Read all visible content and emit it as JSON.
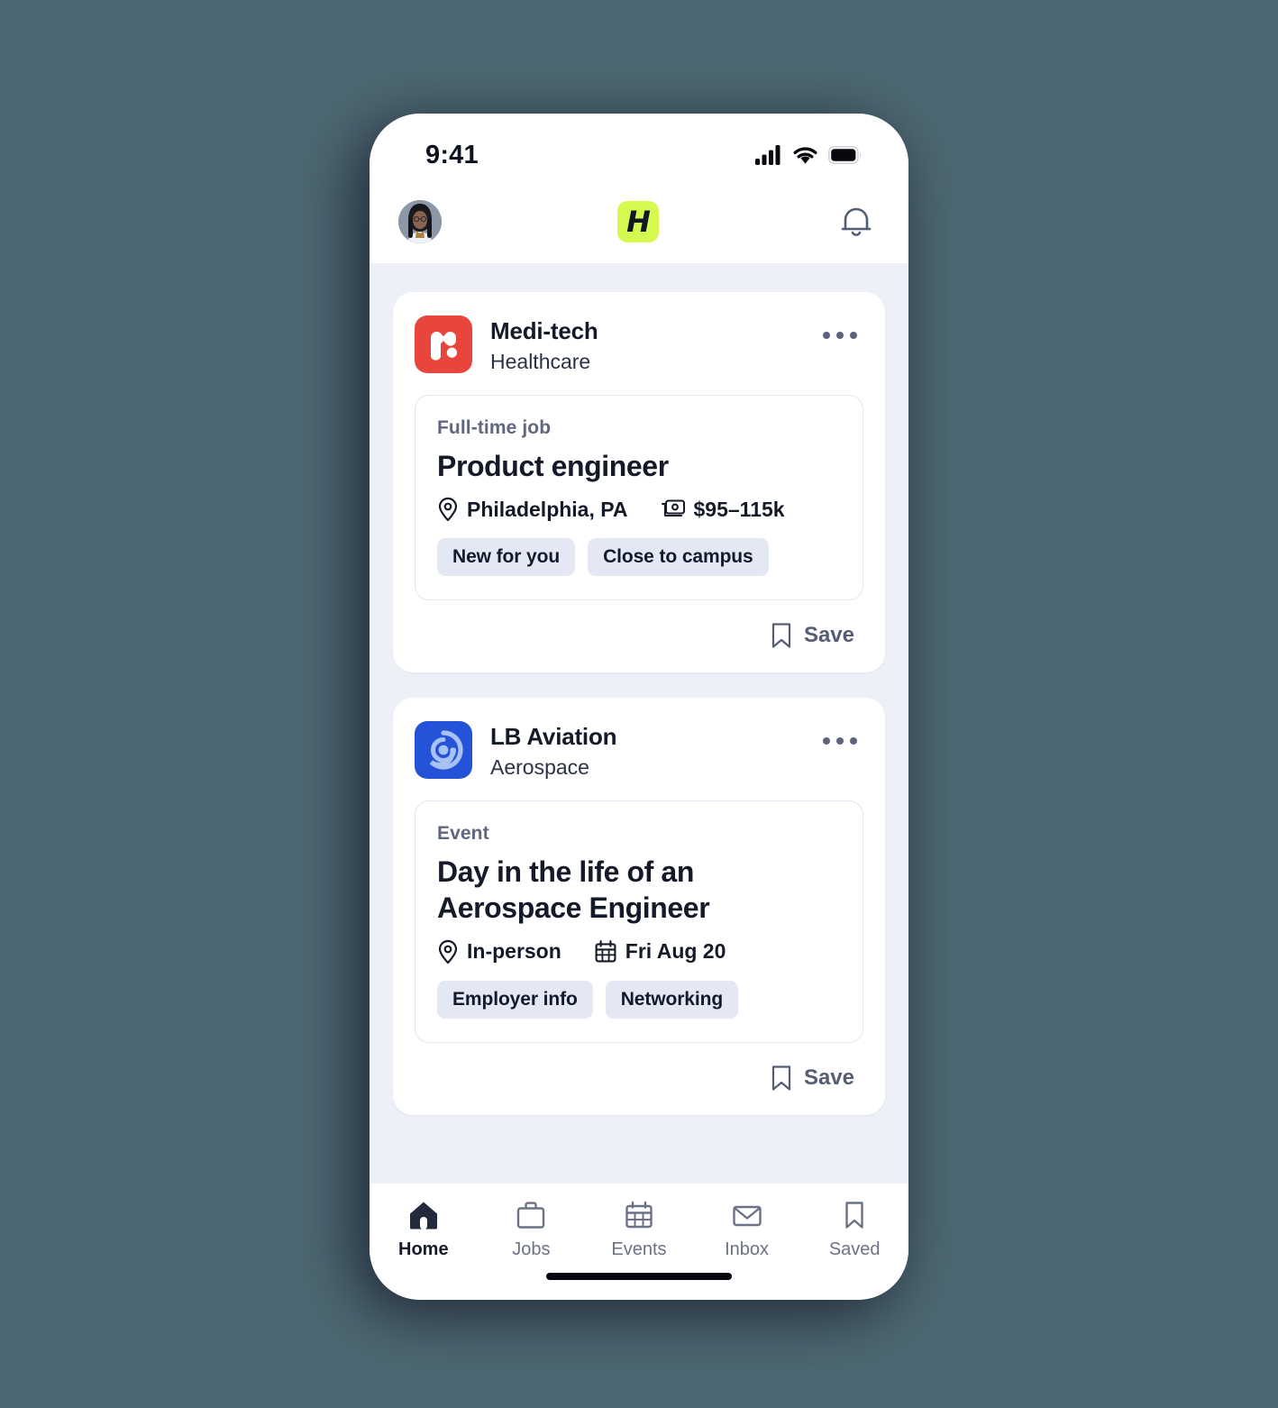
{
  "background_color": "#4d6872",
  "status_bar": {
    "time": "9:41",
    "icons": [
      "cellular-signal-icon",
      "wifi-icon",
      "battery-icon"
    ]
  },
  "app_header": {
    "avatar_name": "avatar",
    "brand_letter": "H",
    "brand_color": "#d6f94f",
    "notifications_icon": "bell-icon"
  },
  "feed": {
    "cards": [
      {
        "org_name": "Medi-tech",
        "org_industry": "Healthcare",
        "logo_color": "#e8453c",
        "logo_icon": "medi-tech-logo",
        "more_icon": "more-options-icon",
        "kicker": "Full-time job",
        "title": "Product engineer",
        "meta": [
          {
            "icon": "location-pin-icon",
            "text": "Philadelphia, PA"
          },
          {
            "icon": "money-icon",
            "text": "$95–115k"
          }
        ],
        "chips": [
          "New for you",
          "Close to campus"
        ],
        "save_label": "Save",
        "save_icon": "bookmark-icon"
      },
      {
        "org_name": "LB Aviation",
        "org_industry": "Aerospace",
        "logo_color": "#2553d8",
        "logo_icon": "lb-aviation-logo",
        "more_icon": "more-options-icon",
        "kicker": "Event",
        "title": "Day in the life of an Aerospace Engineer",
        "meta": [
          {
            "icon": "location-pin-icon",
            "text": "In-person"
          },
          {
            "icon": "calendar-icon",
            "text": "Fri Aug 20"
          }
        ],
        "chips": [
          "Employer info",
          "Networking"
        ],
        "save_label": "Save",
        "save_icon": "bookmark-icon"
      }
    ]
  },
  "tabbar": {
    "items": [
      {
        "label": "Home",
        "icon": "home-icon",
        "active": true
      },
      {
        "label": "Jobs",
        "icon": "briefcase-icon",
        "active": false
      },
      {
        "label": "Events",
        "icon": "calendar-icon",
        "active": false
      },
      {
        "label": "Inbox",
        "icon": "envelope-icon",
        "active": false
      },
      {
        "label": "Saved",
        "icon": "bookmark-icon",
        "active": false
      }
    ]
  }
}
